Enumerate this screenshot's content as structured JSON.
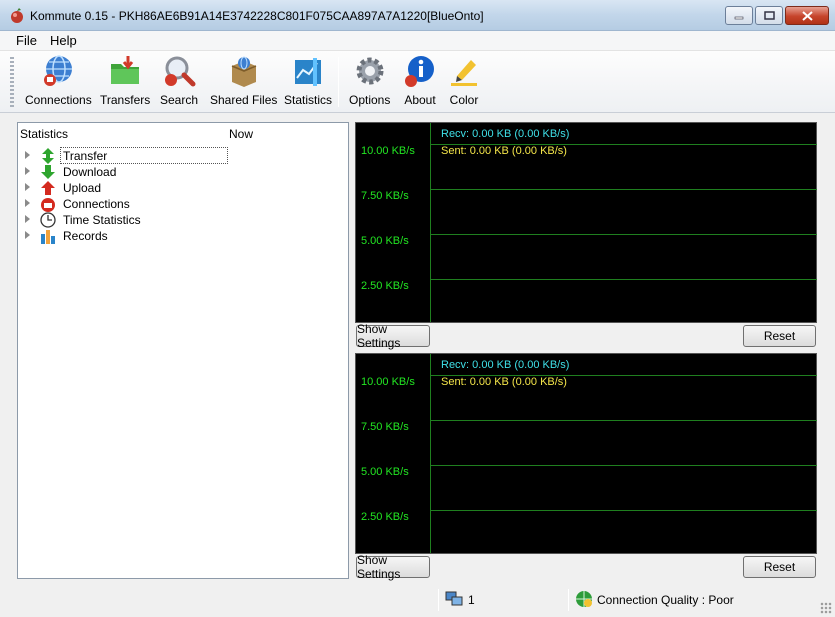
{
  "window": {
    "title": "Kommute 0.15 - PKH86AE6B91A14E3742228C801F075CAA897A7A1220[BlueOnto]"
  },
  "menu": {
    "file": "File",
    "help": "Help"
  },
  "toolbar": {
    "connections": "Connections",
    "transfers": "Transfers",
    "search": "Search",
    "shared_files": "Shared Files",
    "statistics": "Statistics",
    "options": "Options",
    "about": "About",
    "color": "Color"
  },
  "tree": {
    "col_statistics": "Statistics",
    "col_now": "Now",
    "items": [
      {
        "label": "Transfer",
        "icon": "transfer-icon"
      },
      {
        "label": "Download",
        "icon": "download-arrow-icon"
      },
      {
        "label": "Upload",
        "icon": "upload-arrow-icon"
      },
      {
        "label": "Connections",
        "icon": "connections-icon"
      },
      {
        "label": "Time Statistics",
        "icon": "clock-icon"
      },
      {
        "label": "Records",
        "icon": "records-icon"
      }
    ]
  },
  "graphs": [
    {
      "recv": "Recv: 0.00 KB (0.00 KB/s)",
      "sent": "Sent: 0.00 KB (0.00 KB/s)",
      "y_labels": [
        "10.00 KB/s",
        "7.50 KB/s",
        "5.00 KB/s",
        "2.50 KB/s"
      ],
      "show_settings": "Show Settings",
      "reset": "Reset"
    },
    {
      "recv": "Recv: 0.00 KB (0.00 KB/s)",
      "sent": "Sent: 0.00 KB (0.00 KB/s)",
      "y_labels": [
        "10.00 KB/s",
        "7.50 KB/s",
        "5.00 KB/s",
        "2.50 KB/s"
      ],
      "show_settings": "Show Settings",
      "reset": "Reset"
    }
  ],
  "statusbar": {
    "users": "1",
    "connection_quality": "Connection Quality :  Poor"
  },
  "colors": {
    "graph_bg": "#000000",
    "grid": "#1f7f1f",
    "axis_label": "#22e622",
    "recv": "#3fe0e8",
    "sent": "#f5e64a"
  }
}
